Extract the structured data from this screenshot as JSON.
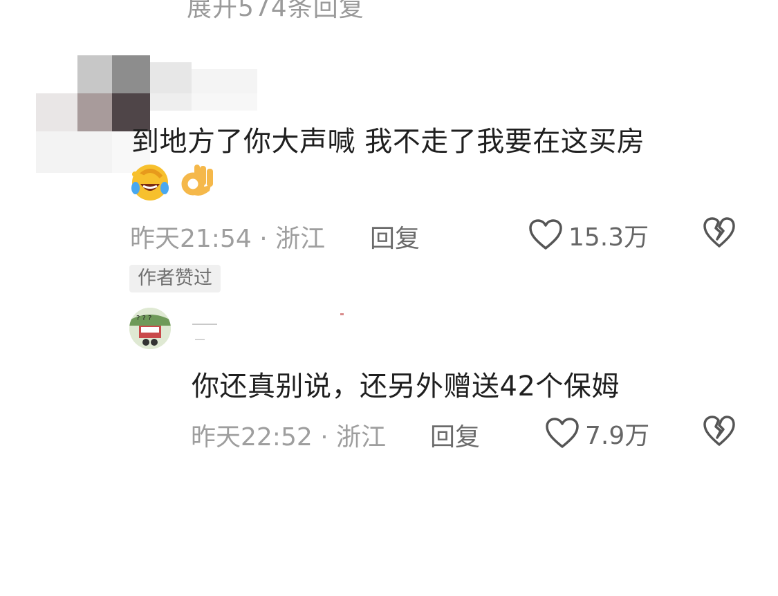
{
  "top_partial_text": "展开574条回复",
  "comment1": {
    "text": "到地方了你大声喊 我不走了我要在这买房",
    "emojis": [
      "laughing-crying-emoji",
      "ok-hand-emoji"
    ],
    "time_location": "昨天21:54 · 浙江",
    "reply_label": "回复",
    "likes": "15.3万",
    "author_badge": "作者赞过"
  },
  "comment2": {
    "text": "你还真别说，还另外赠送42个保姆",
    "time_location": "昨天22:52 · 浙江",
    "reply_label": "回复",
    "likes": "7.9万"
  },
  "icons": {
    "like": "heart-outline-icon",
    "dislike": "broken-heart-icon"
  }
}
